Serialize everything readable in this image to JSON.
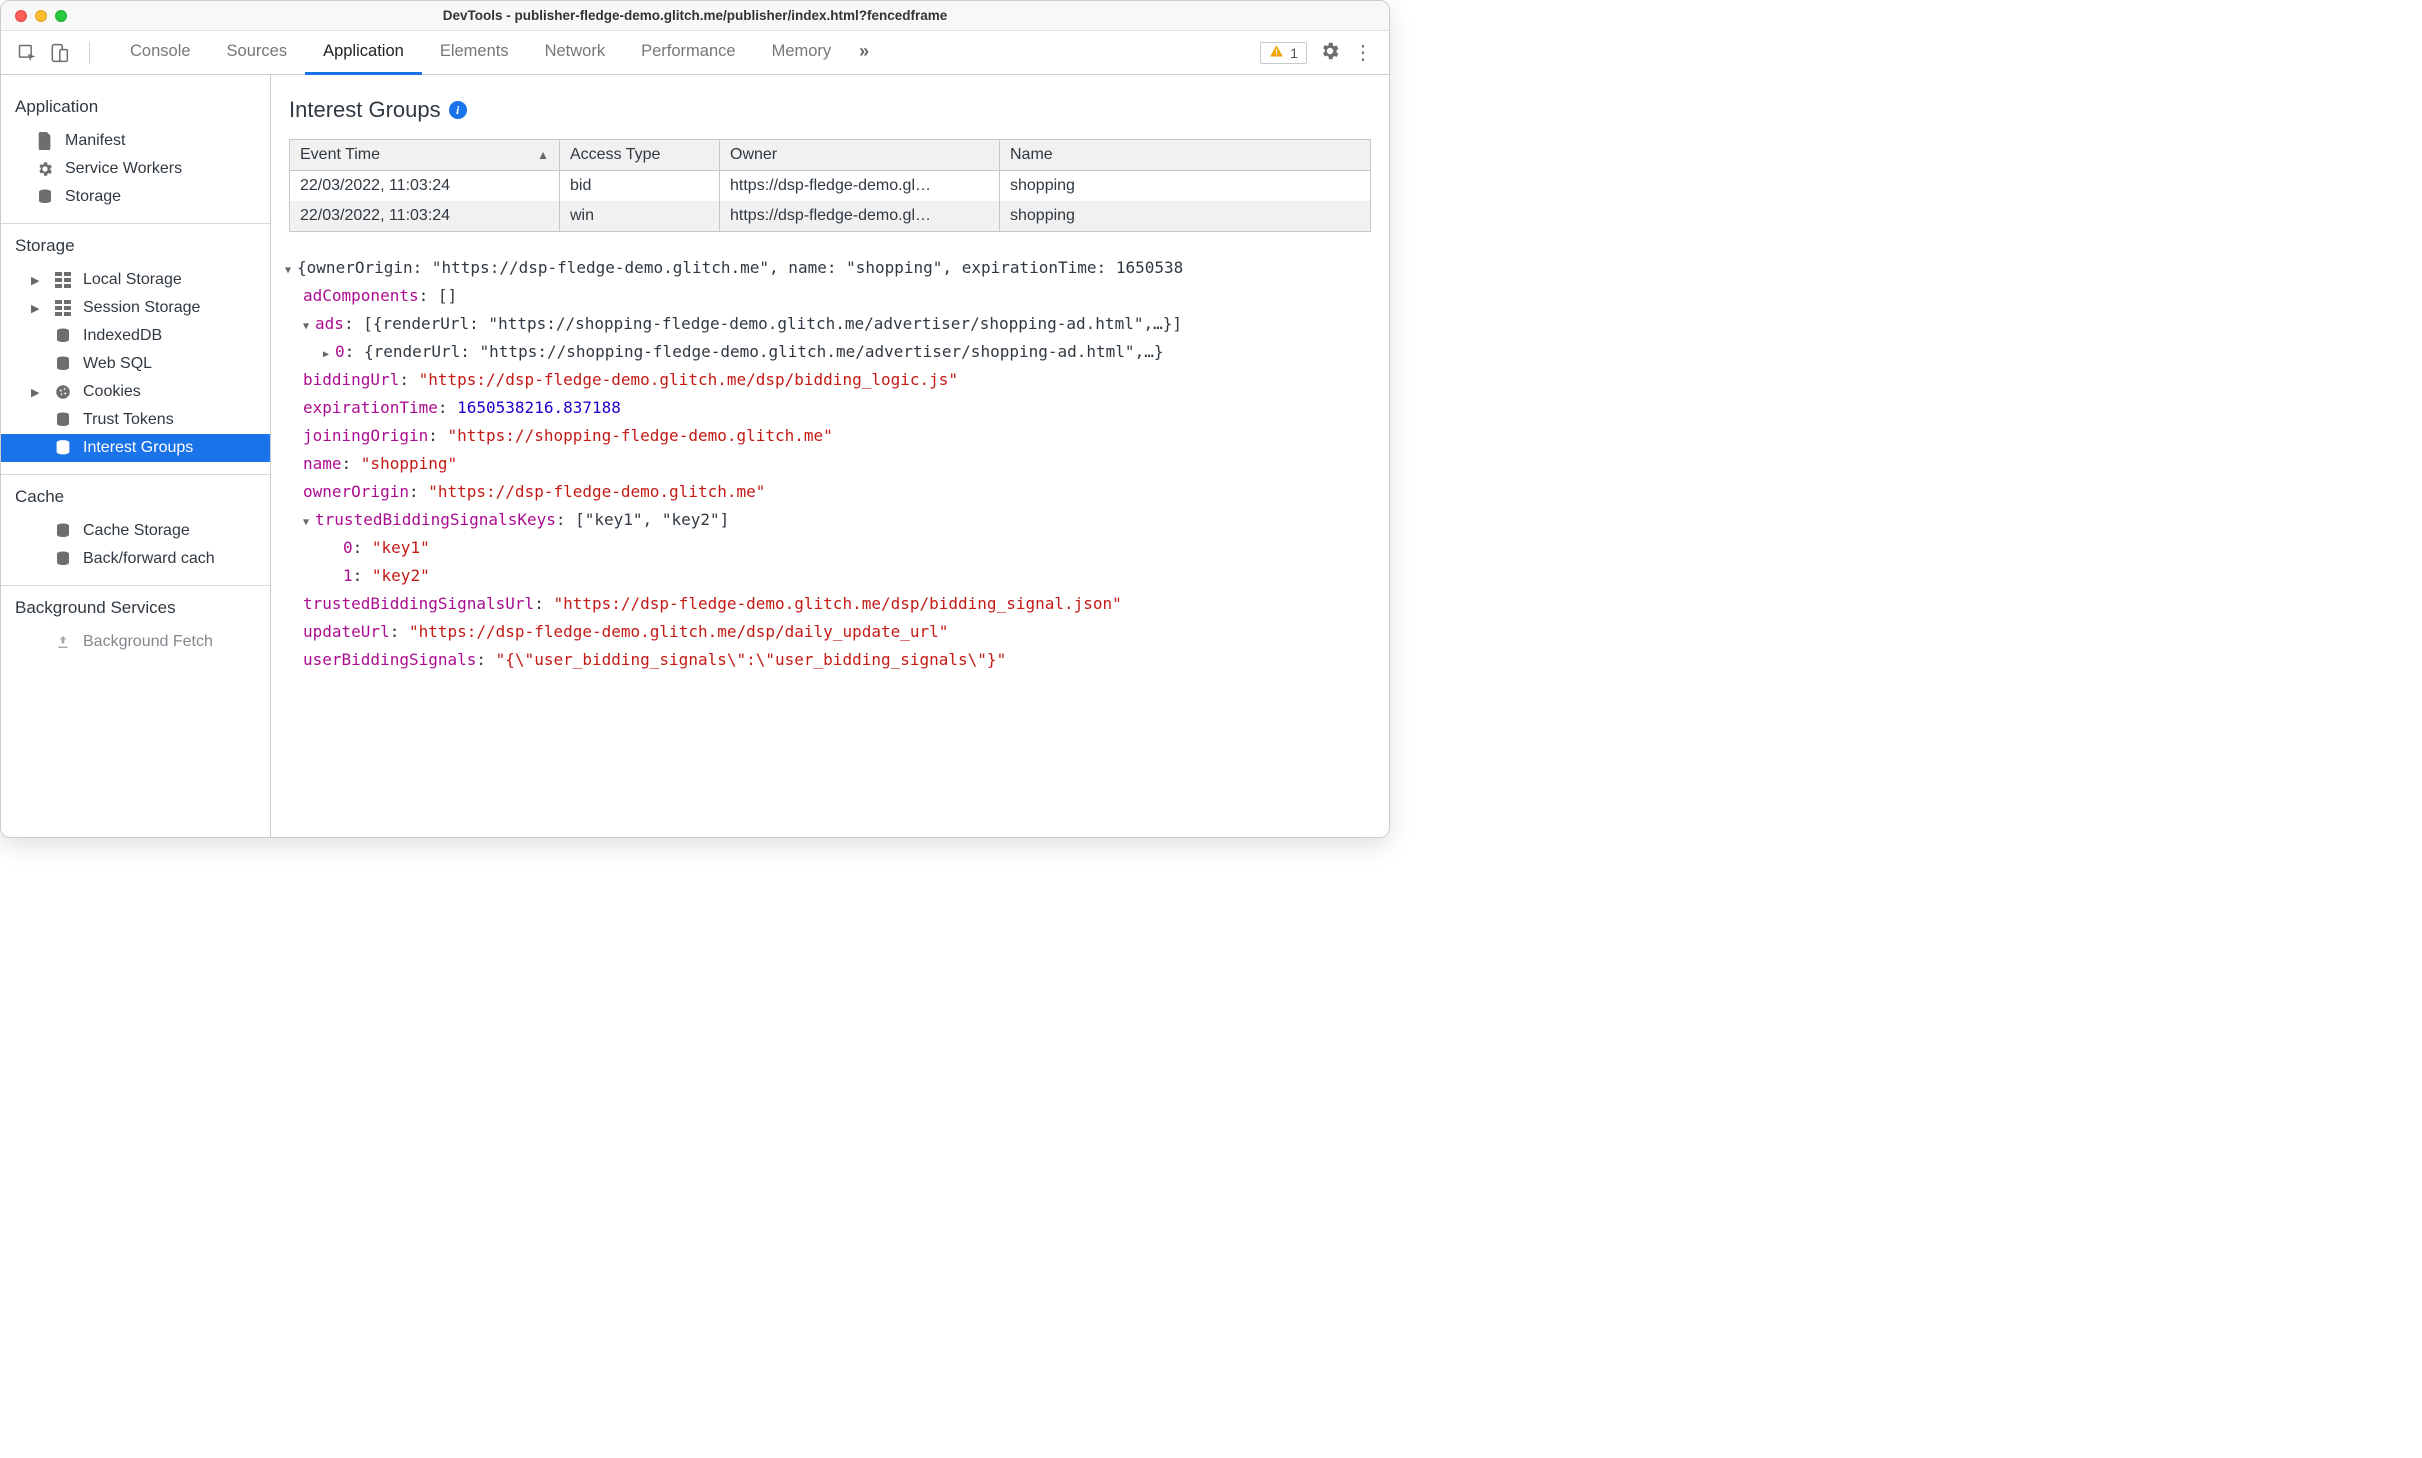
{
  "window": {
    "title": "DevTools - publisher-fledge-demo.glitch.me/publisher/index.html?fencedframe"
  },
  "tabs": {
    "list": [
      "Console",
      "Sources",
      "Application",
      "Elements",
      "Network",
      "Performance",
      "Memory"
    ],
    "active": "Application",
    "more": "»",
    "warnings": "1"
  },
  "sidebar": {
    "application": {
      "heading": "Application",
      "items": [
        "Manifest",
        "Service Workers",
        "Storage"
      ]
    },
    "storage": {
      "heading": "Storage",
      "items": [
        "Local Storage",
        "Session Storage",
        "IndexedDB",
        "Web SQL",
        "Cookies",
        "Trust Tokens",
        "Interest Groups"
      ],
      "selected": "Interest Groups"
    },
    "cache": {
      "heading": "Cache",
      "items": [
        "Cache Storage",
        "Back/forward cach"
      ]
    },
    "bg": {
      "heading": "Background Services",
      "items": [
        "Background Fetch"
      ]
    }
  },
  "content": {
    "title": "Interest Groups",
    "info_glyph": "i",
    "table": {
      "headers": [
        "Event Time",
        "Access Type",
        "Owner",
        "Name"
      ],
      "sorted_col": 0,
      "rows": [
        {
          "time": "22/03/2022, 11:03:24",
          "type": "bid",
          "owner": "https://dsp-fledge-demo.gl…",
          "name": "shopping"
        },
        {
          "time": "22/03/2022, 11:03:24",
          "type": "win",
          "owner": "https://dsp-fledge-demo.gl…",
          "name": "shopping"
        }
      ]
    },
    "detail": {
      "summary": "{ownerOrigin: \"https://dsp-fledge-demo.glitch.me\", name: \"shopping\", expirationTime: 1650538",
      "adComponents_label": "adComponents",
      "adComponents_value": "[]",
      "ads_label": "ads",
      "ads_value": "[{renderUrl: \"https://shopping-fledge-demo.glitch.me/advertiser/shopping-ad.html\",…}]",
      "ads0_label": "0",
      "ads0_value": "{renderUrl: \"https://shopping-fledge-demo.glitch.me/advertiser/shopping-ad.html\",…}",
      "biddingUrl_label": "biddingUrl",
      "biddingUrl_value": "\"https://dsp-fledge-demo.glitch.me/dsp/bidding_logic.js\"",
      "expirationTime_label": "expirationTime",
      "expirationTime_value": "1650538216.837188",
      "joiningOrigin_label": "joiningOrigin",
      "joiningOrigin_value": "\"https://shopping-fledge-demo.glitch.me\"",
      "name_label": "name",
      "name_value": "\"shopping\"",
      "ownerOrigin_label": "ownerOrigin",
      "ownerOrigin_value": "\"https://dsp-fledge-demo.glitch.me\"",
      "tbsKeys_label": "trustedBiddingSignalsKeys",
      "tbsKeys_value": "[\"key1\", \"key2\"]",
      "tbsKeys0_label": "0",
      "tbsKeys0_value": "\"key1\"",
      "tbsKeys1_label": "1",
      "tbsKeys1_value": "\"key2\"",
      "tbsUrl_label": "trustedBiddingSignalsUrl",
      "tbsUrl_value": "\"https://dsp-fledge-demo.glitch.me/dsp/bidding_signal.json\"",
      "updateUrl_label": "updateUrl",
      "updateUrl_value": "\"https://dsp-fledge-demo.glitch.me/dsp/daily_update_url\"",
      "userBiddingSignals_label": "userBiddingSignals",
      "userBiddingSignals_value": "\"{\\\"user_bidding_signals\\\":\\\"user_bidding_signals\\\"}\""
    }
  }
}
